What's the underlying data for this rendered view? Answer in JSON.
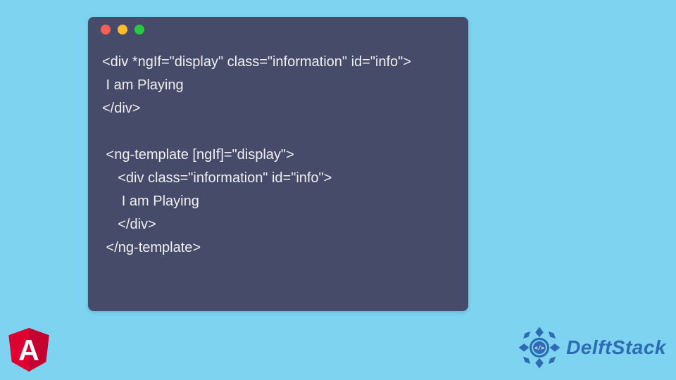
{
  "code": {
    "lines": [
      "<div *ngIf=\"display\" class=\"information\" id=\"info\">",
      " I am Playing",
      "</div>",
      "",
      " <ng-template [ngIf]=\"display\">",
      "    <div class=\"information\" id=\"info\">",
      "     I am Playing",
      "    </div>",
      " </ng-template>"
    ]
  },
  "logos": {
    "angular_letter": "A",
    "delft_text": "DelftStack",
    "delft_code": "</>"
  },
  "colors": {
    "page_bg": "#7dd3f0",
    "code_bg": "#464b69",
    "code_fg": "#f0f0f4",
    "dot_red": "#ff5f56",
    "dot_yellow": "#ffbd2e",
    "dot_green": "#27c93f",
    "angular_red": "#dd0031",
    "angular_red_dark": "#c3002f",
    "delft_blue": "#2e6bb5"
  }
}
